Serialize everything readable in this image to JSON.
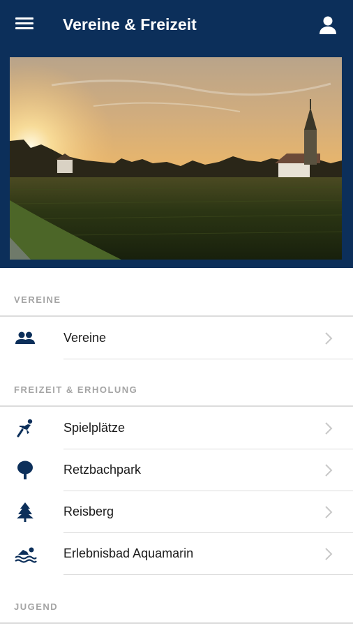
{
  "app": {
    "title": "Vereine & Freizeit",
    "accent_color": "#0c2f5a"
  },
  "header": {
    "menu_icon": "hamburger-menu-icon",
    "profile_icon": "person-icon"
  },
  "sections": [
    {
      "header": "VEREINE",
      "items": [
        {
          "label": "Vereine",
          "icon": "people-icon"
        }
      ]
    },
    {
      "header": "FREIZEIT & ERHOLUNG",
      "items": [
        {
          "label": "Spielplätze",
          "icon": "playground-icon"
        },
        {
          "label": "Retzbachpark",
          "icon": "tree-icon"
        },
        {
          "label": "Reisberg",
          "icon": "pine-tree-icon"
        },
        {
          "label": "Erlebnisbad Aquamarin",
          "icon": "swimmer-icon"
        }
      ]
    },
    {
      "header": "JUGEND",
      "items": []
    }
  ]
}
